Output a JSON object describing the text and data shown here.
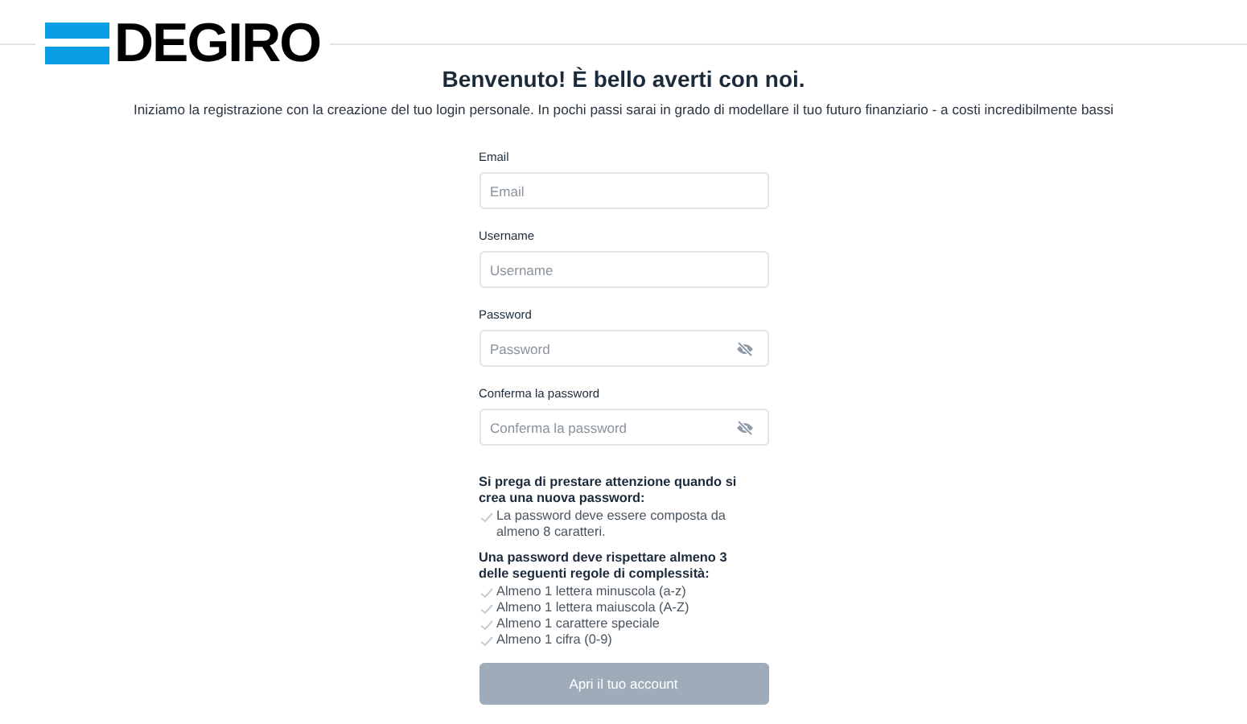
{
  "logo": {
    "text": "DEGIRO"
  },
  "title": "Benvenuto! È bello averti con noi.",
  "subtitle": "Iniziamo la registrazione con la creazione del tuo login personale. In pochi passi sarai in grado di modellare il tuo futuro finanziario - a costi incredibilmente bassi",
  "fields": [
    {
      "label": "Email",
      "placeholder": "Email",
      "kind": "text"
    },
    {
      "label": "Username",
      "placeholder": "Username",
      "kind": "text"
    },
    {
      "label": "Password",
      "placeholder": "Password",
      "kind": "password"
    },
    {
      "label": "Conferma la password",
      "placeholder": "Conferma la password",
      "kind": "password"
    }
  ],
  "rule_groups": [
    {
      "heading": "Si prega di prestare attenzione quando si crea una nuova password:",
      "rules": [
        {
          "text": "La password deve essere composta da almeno 8 caratteri.",
          "met": false
        }
      ]
    },
    {
      "heading": "Una password deve rispettare almeno 3 delle seguenti regole di complessità:",
      "rules": [
        {
          "text": "Almeno 1 lettera minuscola (a-z)",
          "met": false
        },
        {
          "text": "Almeno 1 lettera maiuscola (A-Z)",
          "met": false
        },
        {
          "text": "Almeno 1 carattere speciale",
          "met": false
        },
        {
          "text": "Almeno 1 cifra (0-9)",
          "met": false
        }
      ]
    }
  ],
  "submit": {
    "label": "Apri il tuo account",
    "disabled": true
  }
}
